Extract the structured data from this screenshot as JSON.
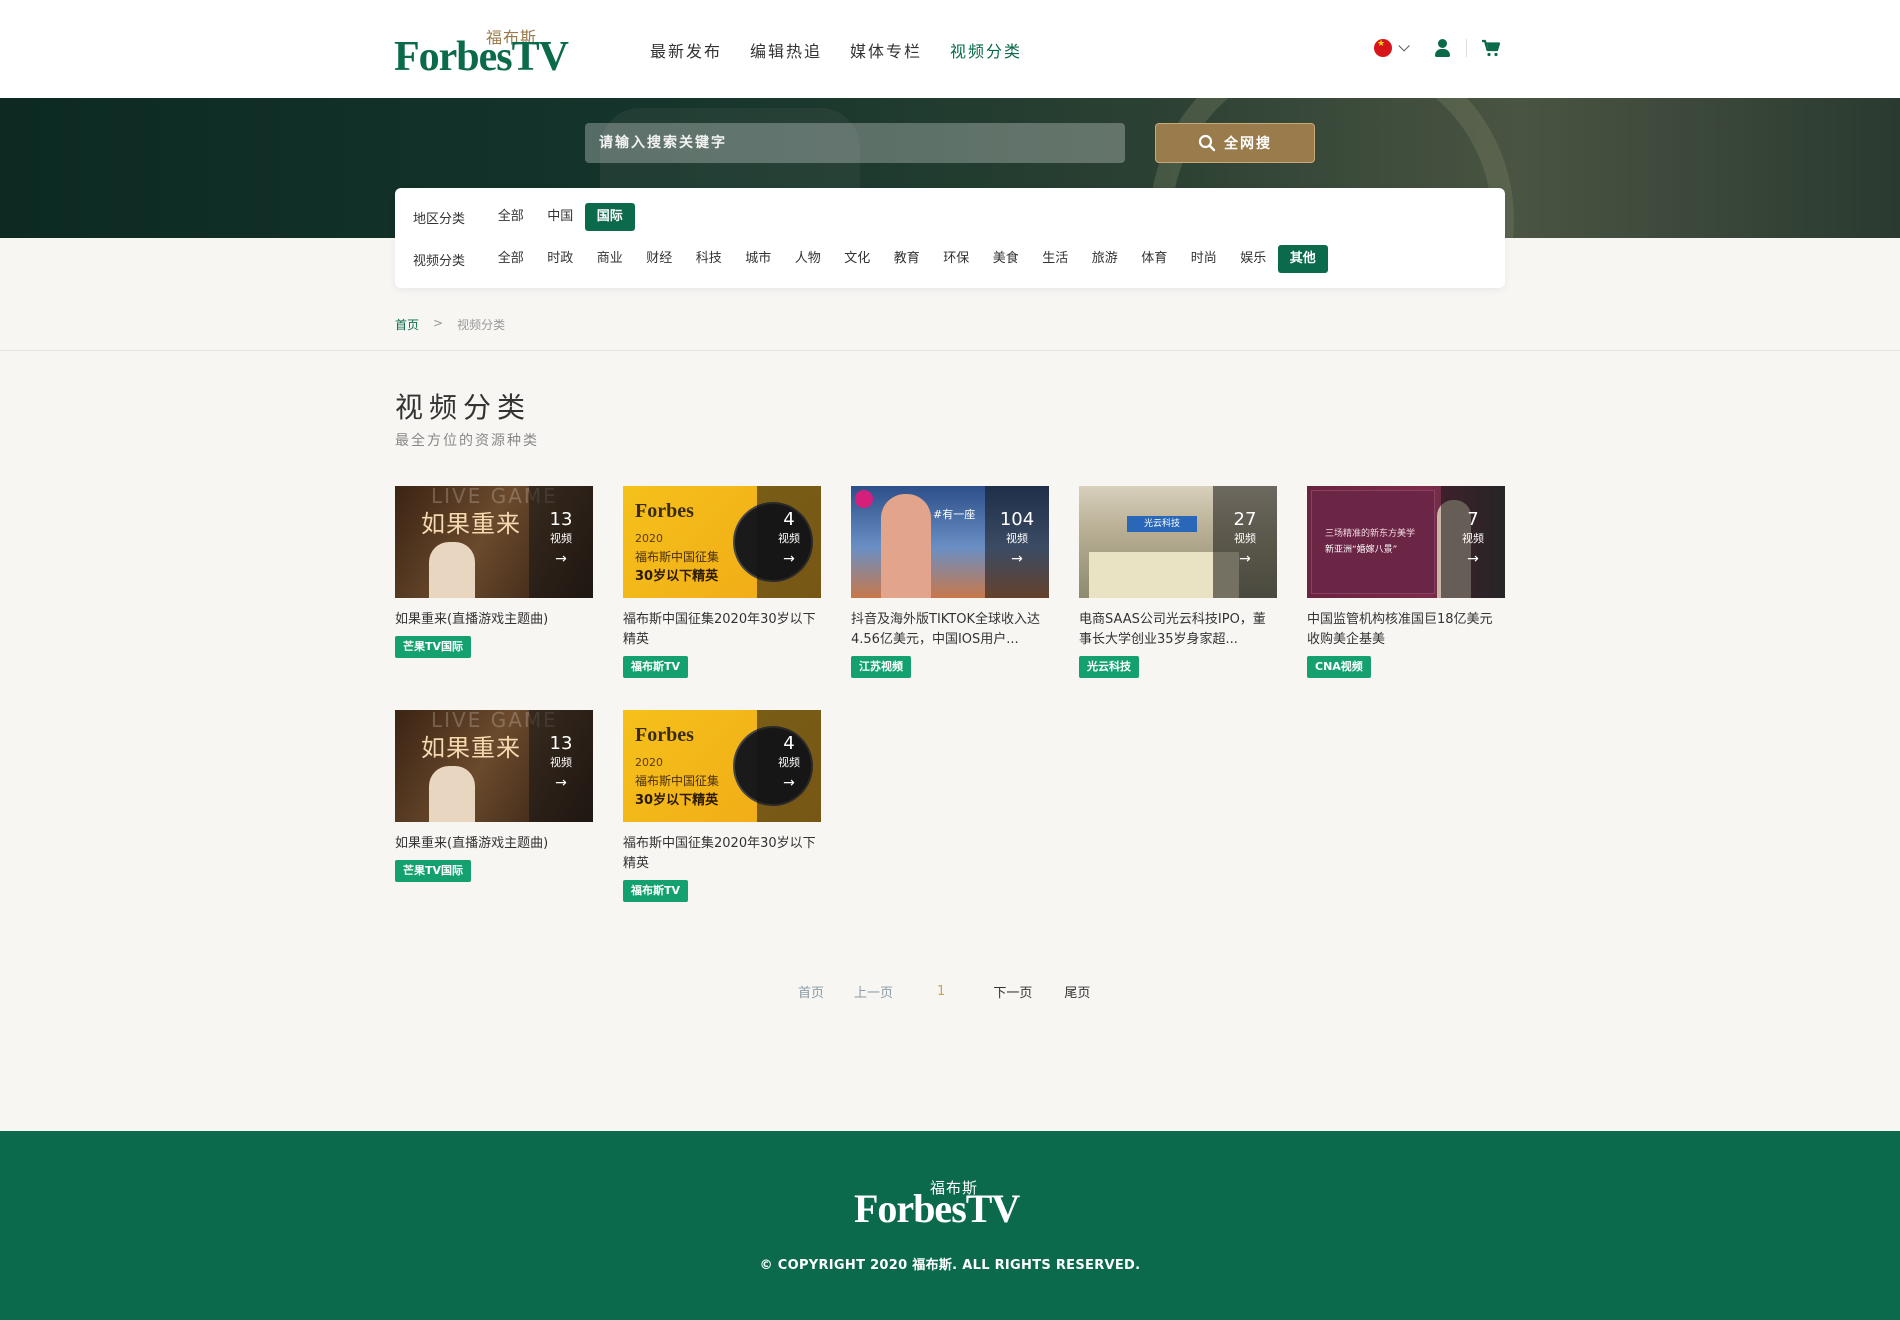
{
  "header": {
    "logo_cn": "福布斯",
    "logo_en": "ForbesTV",
    "nav": [
      "最新发布",
      "编辑热追",
      "媒体专栏",
      "视频分类"
    ],
    "active_nav": 3
  },
  "search": {
    "placeholder": "请输入搜索关键字",
    "button_label": "全网搜"
  },
  "filter": {
    "region_label": "地区分类",
    "regions": [
      "全部",
      "中国",
      "国际"
    ],
    "region_active": 2,
    "video_label": "视频分类",
    "categories": [
      "全部",
      "时政",
      "商业",
      "财经",
      "科技",
      "城市",
      "人物",
      "文化",
      "教育",
      "环保",
      "美食",
      "生活",
      "旅游",
      "体育",
      "时尚",
      "娱乐",
      "其他"
    ],
    "category_active": 16
  },
  "breadcrumb": {
    "home": "首页",
    "sep": ">",
    "current": "视频分类"
  },
  "page": {
    "title": "视频分类",
    "subtitle": "最全方位的资源种类"
  },
  "count_label": "视频",
  "cards": [
    {
      "title": "如果重来(直播游戏主题曲)",
      "count": "13",
      "tag": "芒果TV国际",
      "art": "mango",
      "art_text": "如果重来",
      "art_ghost": "LIVE GAME"
    },
    {
      "title": "福布斯中国征集2020年30岁以下精英",
      "count": "4",
      "tag": "福布斯TV",
      "art": "forbes",
      "art_f": "Forbes",
      "art_y": "2020",
      "art_t1": "福布斯中国征集",
      "art_t2": "30岁以下精英"
    },
    {
      "title": "抖音及海外版TIKTOK全球收入达4.56亿美元，中国IOS用户...",
      "count": "104",
      "tag": "江苏视频",
      "art": "tiktok",
      "art_text": "#有一座"
    },
    {
      "title": "电商SAAS公司光云科技IPO，董事长大学创业35岁身家超...",
      "count": "27",
      "tag": "光云科技",
      "art": "gy",
      "art_text": "光云科技"
    },
    {
      "title": "中国监管机构核准国巨18亿美元收购美企基美",
      "count": "7",
      "tag": "CNA视频",
      "art": "cna",
      "art_l1": "三场精准的新东方美学",
      "art_l2": "新亚洲“婚嫁八景”"
    },
    {
      "title": "如果重来(直播游戏主题曲)",
      "count": "13",
      "tag": "芒果TV国际",
      "art": "mango",
      "art_text": "如果重来",
      "art_ghost": "LIVE GAME"
    },
    {
      "title": "福布斯中国征集2020年30岁以下精英",
      "count": "4",
      "tag": "福布斯TV",
      "art": "forbes",
      "art_f": "Forbes",
      "art_y": "2020",
      "art_t1": "福布斯中国征集",
      "art_t2": "30岁以下精英"
    }
  ],
  "pagination": {
    "first": "首页",
    "prev": "上一页",
    "current": "1",
    "next": "下一页",
    "last": "尾页"
  },
  "footer": {
    "logo_cn": "福布斯",
    "logo_en": "ForbesTV",
    "copyright": "© COPYRIGHT 2020 福布斯. ALL RIGHTS RESERVED."
  },
  "colors": {
    "brand_green": "#0a6a4b",
    "accent_gold": "#9a7b4c",
    "tag_green": "#14a06f"
  }
}
